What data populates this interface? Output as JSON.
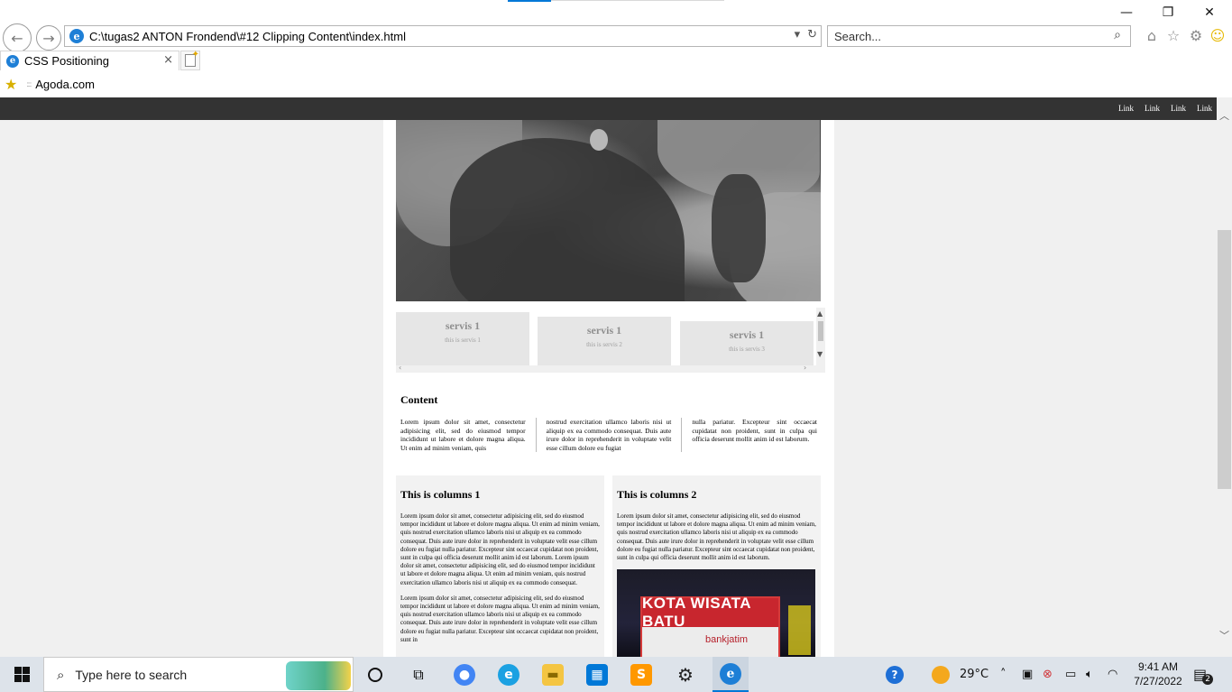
{
  "window": {
    "minimize": "—",
    "restore": "❐",
    "close": "✕"
  },
  "navigation": {
    "back_icon": "←",
    "forward_icon": "→",
    "address": "C:\\tugas2 ANTON Frondend\\#12 Clipping Content\\index.html",
    "address_dropdown": "▾",
    "refresh": "↻",
    "search_placeholder": "Search...",
    "search_icon": "⌕",
    "home_icon": "⌂",
    "favorites_icon": "☆",
    "settings_icon": "⚙",
    "smiley_icon": "☺"
  },
  "tabs": [
    {
      "title": "CSS Positioning",
      "close": "×"
    }
  ],
  "favorites_bar": {
    "item": "Agoda.com"
  },
  "site": {
    "nav_links": [
      "Link",
      "Link",
      "Link",
      "Link"
    ],
    "services": [
      {
        "title": "servis 1",
        "subtitle": "this is servis 1"
      },
      {
        "title": "servis 1",
        "subtitle": "this is servis 2"
      },
      {
        "title": "servis 1",
        "subtitle": "this is servis 3"
      }
    ],
    "content": {
      "heading": "Content",
      "col1": "Lorem ipsum dolor sit amet, consectetur adipisicing elit, sed do eiusmod tempor incididunt ut labore et dolore magna aliqua. Ut enim ad minim veniam, quis",
      "col2": "nostrud exercitation ullamco laboris nisi ut aliquip ex ea commodo consequat. Duis aute irure dolor in reprehenderit in voluptate velit esse cillum dolore eu fugiat",
      "col3": "nulla pariatur. Excepteur sint occaecat cupidatat non proident, sunt in culpa qui officia deserunt mollit anim id est laborum."
    },
    "column1": {
      "title": "This is columns 1",
      "para1": "Lorem ipsum dolor sit amet, consectetur adipisicing elit, sed do eiusmod tempor incididunt ut labore et dolore magna aliqua. Ut enim ad minim veniam, quis nostrud exercitation ullamco laboris nisi ut aliquip ex ea commodo consequat. Duis aute irure dolor in reprehenderit in voluptate velit esse cillum dolore eu fugiat nulla pariatur. Excepteur sint occaecat cupidatat non proident, sunt in culpa qui officia deserunt mollit anim id est laborum. Lorem ipsum dolor sit amet, consectetur adipisicing elit, sed do eiusmod tempor incididunt ut labore et dolore magna aliqua. Ut enim ad minim veniam, quis nostrud exercitation ullamco laboris nisi ut aliquip ex ea commodo consequat.",
      "para2": "Lorem ipsum dolor sit amet, consectetur adipisicing elit, sed do eiusmod tempor incididunt ut labore et dolore magna aliqua. Ut enim ad minim veniam, quis nostrud exercitation ullamco laboris nisi ut aliquip ex ea commodo consequat. Duis aute irure dolor in reprehenderit in voluptate velit esse cillum dolore eu fugiat nulla pariatur. Excepteur sint occaecat cupidatat non proident, sunt in"
    },
    "column2": {
      "title": "This is columns 2",
      "para1": "Lorem ipsum dolor sit amet, consectetur adipisicing elit, sed do eiusmod tempor incididunt ut labore et dolore magna aliqua. Ut enim ad minim veniam, quis nostrud exercitation ullamco laboris nisi ut aliquip ex ea commodo consequat. Duis aute irure dolor in reprehenderit in voluptate velit esse cillum dolore eu fugiat nulla pariatur. Excepteur sint occaecat cupidatat non proident, sunt in culpa qui officia deserunt mollit anim id est laborum.",
      "photo_sign": "KOTA WISATA BATU",
      "photo_bank": "bankjatim"
    }
  },
  "taskbar": {
    "search_placeholder": "Type here to search",
    "weather": "29°C",
    "time": "9:41 AM",
    "date": "7/27/2022",
    "notifications": "2",
    "colors": {
      "chrome": "#4285f4",
      "edge": "#1ba1e2",
      "explorer": "#f4c542",
      "store": "#0078d7",
      "sublime": "#ff9800",
      "ie": "#1e7fd6"
    }
  }
}
